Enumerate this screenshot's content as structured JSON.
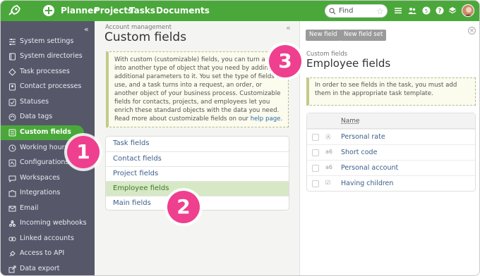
{
  "topbar": {
    "nav": [
      "Planner",
      "Projects",
      "Tasks",
      "Documents"
    ],
    "find_placeholder": "Find",
    "icons": [
      "menu-icon",
      "people-icon",
      "day-icon",
      "help-icon",
      "layers-icon"
    ]
  },
  "sidebar": {
    "collapse_glyph": "«",
    "items": [
      {
        "label": "System settings",
        "icon": "sliders-icon"
      },
      {
        "label": "System directories",
        "icon": "book-icon"
      },
      {
        "label": "Task processes",
        "icon": "diamond-icon"
      },
      {
        "label": "Contact processes",
        "icon": "contact-icon"
      },
      {
        "label": "Statuses",
        "icon": "check-icon"
      },
      {
        "label": "Data tags",
        "icon": "tag-icon"
      },
      {
        "label": "Custom fields",
        "icon": "fields-icon",
        "active": true
      },
      {
        "label": "Working hours",
        "icon": "clock-icon"
      },
      {
        "label": "Configurations",
        "icon": "config-icon"
      },
      {
        "label": "Workspaces",
        "icon": "chat-icon"
      },
      {
        "label": "Integrations",
        "icon": "puzzle-icon"
      },
      {
        "label": "Email",
        "icon": "mail-icon"
      },
      {
        "label": "Incoming webhooks",
        "icon": "webhook-icon"
      },
      {
        "label": "Linked accounts",
        "icon": "link-icon"
      },
      {
        "label": "Access to API",
        "icon": "api-icon"
      },
      {
        "label": "Data export",
        "icon": "export-icon"
      }
    ]
  },
  "middle": {
    "breadcrumb": "Account management",
    "title": "Custom fields",
    "collapse_glyph": "«",
    "info_text": "With custom (customizable) fields, you can turn a task into another type of object that you need by adding additional parameters to it. You set the type of fields to use, and a task turns into a request, an order, or another object of your business process. Customizable fields for contacts, projects, and employees let you enrich these standard objects with the data you need. Read more about customizable fields on our ",
    "info_link": "help page",
    "info_end": ".",
    "list": [
      "Task fields",
      "Contact fields",
      "Project fields",
      "Employee fields",
      "Main fields"
    ],
    "selected_index": 3
  },
  "right": {
    "new_field": "New field",
    "new_field_set": "New field set",
    "breadcrumb": "Custom fields",
    "title": "Employee fields",
    "info_text": "In order to see fields in the task, you must add them in the appropriate task template.",
    "column_name": "Name",
    "rows": [
      {
        "type": "Ⓐ",
        "name": "Personal rate"
      },
      {
        "type": "a6",
        "name": "Short code"
      },
      {
        "type": "a6",
        "name": "Personal account"
      },
      {
        "type": "☑",
        "name": "Having children"
      }
    ]
  },
  "callouts": [
    "1",
    "2",
    "3"
  ],
  "colors": {
    "brand_green": "#4aa83a",
    "sidebar": "#56586a",
    "callout": "#ef3f8f",
    "selected_row": "#d7e8c6"
  }
}
